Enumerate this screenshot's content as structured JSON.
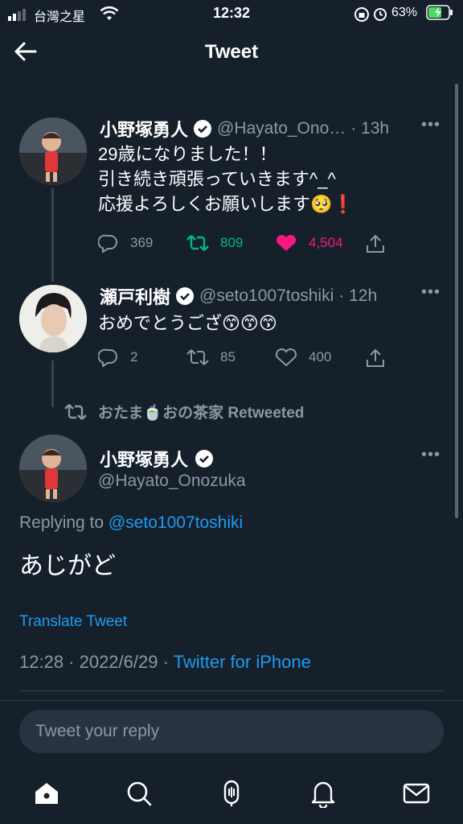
{
  "status_bar": {
    "carrier": "台灣之星",
    "time": "12:32",
    "battery_percent": "63%"
  },
  "header": {
    "title": "Tweet"
  },
  "tweets": [
    {
      "name": "小野塚勇人",
      "handle": "@Hayato_Ono…",
      "time": "· 13h",
      "lines": [
        "29歳になりました！！",
        "引き続き頑張っていきます^_^",
        "応援よろしくお願いします🥺❗"
      ],
      "replies": "369",
      "retweets": "809",
      "likes": "4,504"
    },
    {
      "name": "瀬戸利樹",
      "handle": "@seto1007toshiki",
      "time": "· 12h",
      "lines": [
        "おめでとうござ😙😙😙"
      ],
      "replies": "2",
      "retweets": "85",
      "likes": "400"
    }
  ],
  "retweet_banner": "おたま🍵おの茶家 Retweeted",
  "main_tweet": {
    "name": "小野塚勇人",
    "handle": "@Hayato_Onozuka",
    "replying_to_label": "Replying to",
    "replying_to_handle": "@seto1007toshiki",
    "text": "あじがど",
    "translate": "Translate Tweet",
    "timestamp": "12:28 · 2022/6/29 ·",
    "source": "Twitter for iPhone"
  },
  "reply_box": {
    "placeholder": "Tweet your reply"
  },
  "colors": {
    "background": "#15202b",
    "accent": "#1d9bf0",
    "retweet_green": "#00ba7c",
    "like_pink": "#f91880",
    "muted": "#8b98a5"
  },
  "icons": [
    "back-arrow-icon",
    "verified-icon",
    "reply-icon",
    "retweet-icon",
    "like-icon",
    "share-icon",
    "home-icon",
    "search-icon",
    "spaces-icon",
    "notifications-icon",
    "messages-icon"
  ]
}
